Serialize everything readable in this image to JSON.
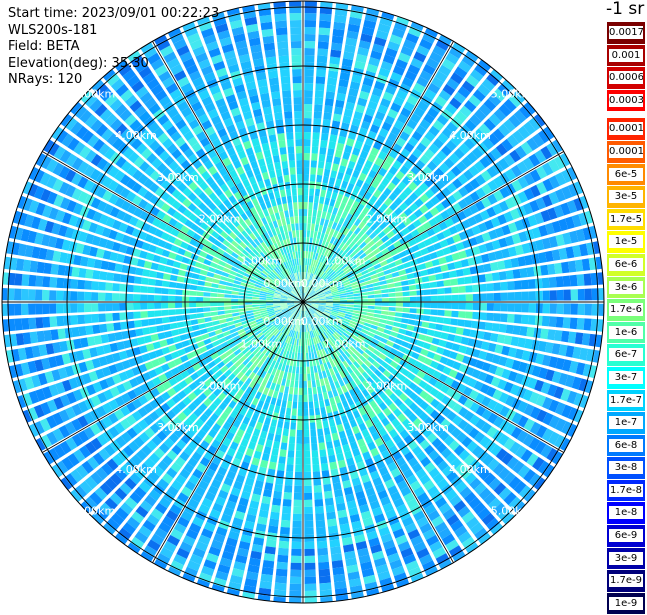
{
  "header": {
    "start_time": "Start time: 2023/09/01 00:22:23",
    "device": "WLS200s-181",
    "field": "Field: BETA",
    "elevation": "Elevation(deg): 35.30",
    "nrays": "NRays: 120"
  },
  "unit_title": "-1 sr",
  "colorbar": {
    "levels": [
      {
        "label": "0.0017",
        "color": "#7a0000"
      },
      {
        "label": "0.001",
        "color": "#a80000"
      },
      {
        "label": "0.0006",
        "color": "#d20000"
      },
      {
        "label": "0.0003",
        "color": "#ff0000"
      },
      {
        "label": "0.00017",
        "color": "#ff2400"
      },
      {
        "label": "0.0001",
        "color": "#ff5a00"
      },
      {
        "label": "6e-5",
        "color": "#ff8a00"
      },
      {
        "label": "3e-5",
        "color": "#ffb400"
      },
      {
        "label": "1.7e-5",
        "color": "#ffdc00"
      },
      {
        "label": "1e-5",
        "color": "#ffff00"
      },
      {
        "label": "6e-6",
        "color": "#d2ff28"
      },
      {
        "label": "3e-6",
        "color": "#a8ff50"
      },
      {
        "label": "1.7e-6",
        "color": "#7aff7a"
      },
      {
        "label": "1e-6",
        "color": "#50ffa8"
      },
      {
        "label": "6e-7",
        "color": "#28ffd2"
      },
      {
        "label": "3e-7",
        "color": "#00ffff"
      },
      {
        "label": "1.7e-7",
        "color": "#00d2ff"
      },
      {
        "label": "1e-7",
        "color": "#00a8ff"
      },
      {
        "label": "6e-8",
        "color": "#007aff"
      },
      {
        "label": "3e-8",
        "color": "#0050ff"
      },
      {
        "label": "1.7e-8",
        "color": "#0028ff"
      },
      {
        "label": "1e-8",
        "color": "#0000ff"
      },
      {
        "label": "6e-9",
        "color": "#0000d2"
      },
      {
        "label": "3e-9",
        "color": "#0000a8"
      },
      {
        "label": "1.7e-9",
        "color": "#00007a"
      },
      {
        "label": "1e-9",
        "color": "#000050"
      }
    ]
  },
  "range_rings": {
    "labels": [
      "0.00km",
      "1.00km",
      "2.00km",
      "3.00km",
      "4.00km",
      "5.00km"
    ]
  },
  "scan": {
    "nrays": 120,
    "spoke_count": 12
  }
}
